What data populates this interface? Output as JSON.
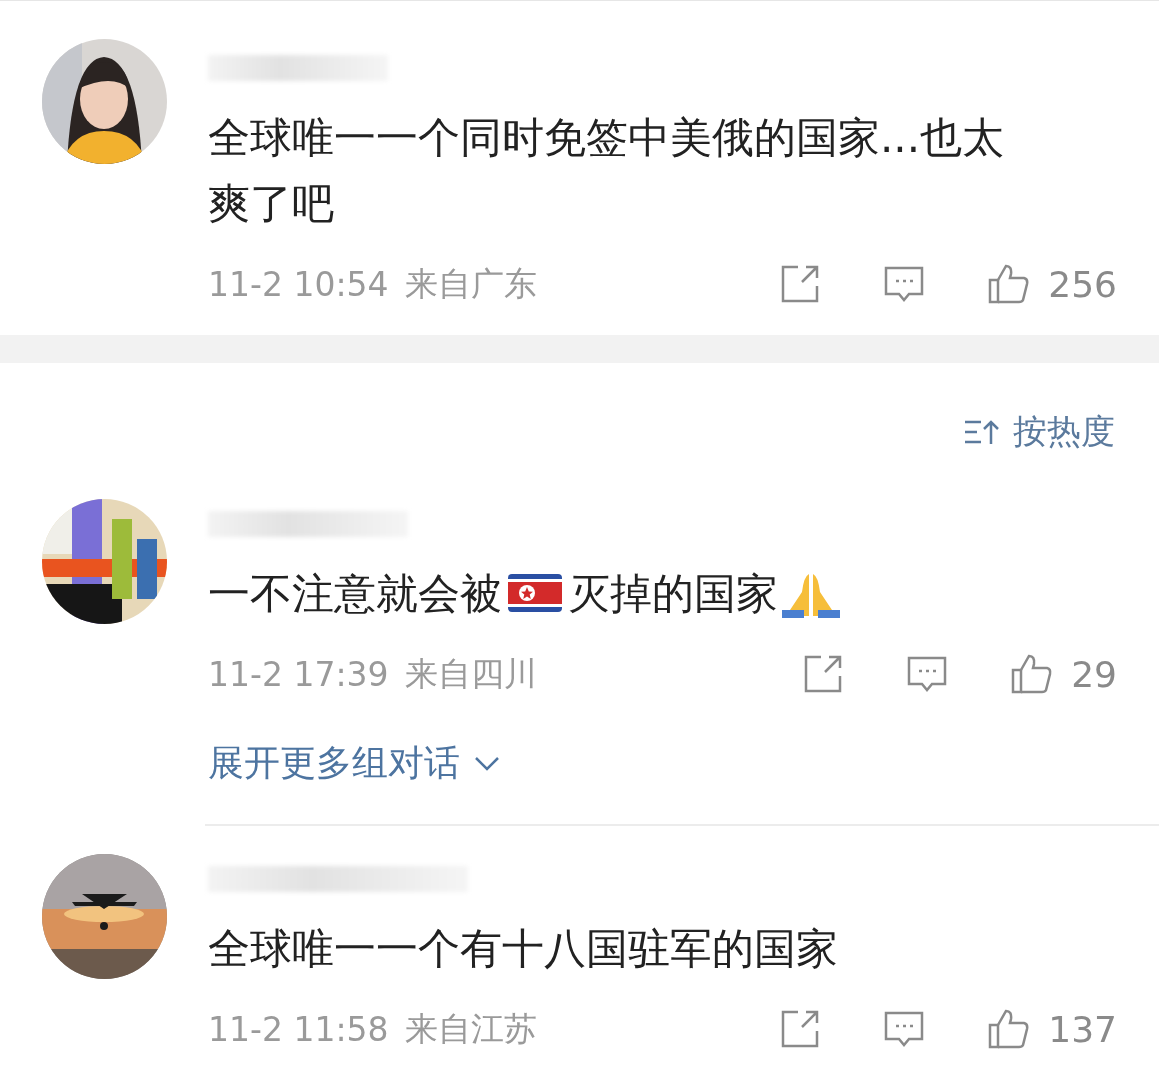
{
  "comments": [
    {
      "parts": [
        {
          "kind": "text",
          "text": "全球唯一一个同时免签中美俄的国家...也太爽了吧"
        }
      ],
      "time": "11-2 10:54",
      "location": "来自广东",
      "likes": "256"
    },
    {
      "sort": "按热度"
    },
    {
      "parts": [
        {
          "kind": "text",
          "text": "一不注意就会被"
        },
        {
          "kind": "flag"
        },
        {
          "kind": "text",
          "text": "灭掉的国家"
        },
        {
          "kind": "hands"
        }
      ],
      "time": "11-2 17:39",
      "location": "来自四川",
      "likes": "29",
      "more": "展开更多组对话"
    },
    {
      "parts": [
        {
          "kind": "text",
          "text": "全球唯一一个有十八国驻军的国家"
        }
      ],
      "time": "11-2 11:58",
      "location": "来自江苏",
      "likes": "137"
    }
  ]
}
